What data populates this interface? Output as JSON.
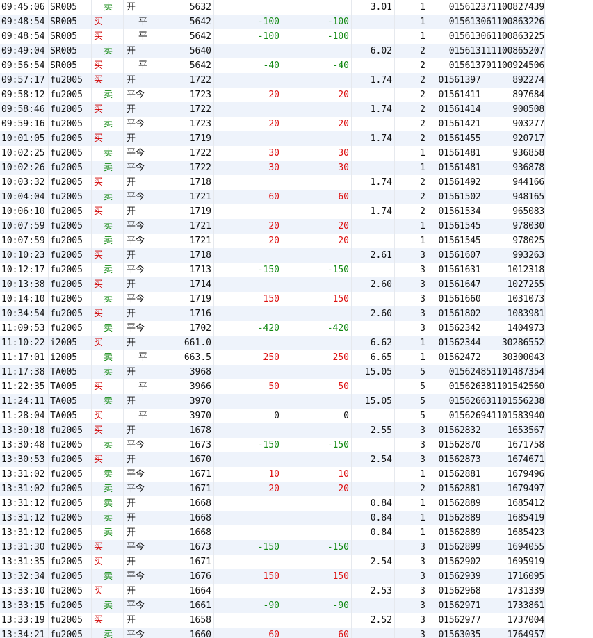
{
  "rows": [
    {
      "time": "09:45:06",
      "code": "SR005",
      "side": "卖",
      "oc": "开",
      "price": "5632",
      "pnl": "",
      "pnl2": "",
      "fee": "3.01",
      "lots": "1",
      "order": "015612371100827439"
    },
    {
      "time": "09:48:54",
      "code": "SR005",
      "side": "买",
      "oc": "平",
      "price": "5642",
      "pnl": "-100",
      "pnl2": "-100",
      "fee": "",
      "lots": "1",
      "order": "015613061100863226"
    },
    {
      "time": "09:48:54",
      "code": "SR005",
      "side": "买",
      "oc": "平",
      "price": "5642",
      "pnl": "-100",
      "pnl2": "-100",
      "fee": "",
      "lots": "1",
      "order": "015613061100863225"
    },
    {
      "time": "09:49:04",
      "code": "SR005",
      "side": "卖",
      "oc": "开",
      "price": "5640",
      "pnl": "",
      "pnl2": "",
      "fee": "6.02",
      "lots": "2",
      "order": "015613111100865207"
    },
    {
      "time": "09:56:54",
      "code": "SR005",
      "side": "买",
      "oc": "平",
      "price": "5642",
      "pnl": "-40",
      "pnl2": "-40",
      "fee": "",
      "lots": "2",
      "order": "015613791100924506"
    },
    {
      "time": "09:57:17",
      "code": "fu2005",
      "side": "买",
      "oc": "开",
      "price": "1722",
      "pnl": "",
      "pnl2": "",
      "fee": "1.74",
      "lots": "2",
      "order": "01561397      892274"
    },
    {
      "time": "09:58:12",
      "code": "fu2005",
      "side": "卖",
      "oc": "平今",
      "price": "1723",
      "pnl": "20",
      "pnl2": "20",
      "fee": "",
      "lots": "2",
      "order": "01561411      897684"
    },
    {
      "time": "09:58:46",
      "code": "fu2005",
      "side": "买",
      "oc": "开",
      "price": "1722",
      "pnl": "",
      "pnl2": "",
      "fee": "1.74",
      "lots": "2",
      "order": "01561414      900508"
    },
    {
      "time": "09:59:16",
      "code": "fu2005",
      "side": "卖",
      "oc": "平今",
      "price": "1723",
      "pnl": "20",
      "pnl2": "20",
      "fee": "",
      "lots": "2",
      "order": "01561421      903277"
    },
    {
      "time": "10:01:05",
      "code": "fu2005",
      "side": "买",
      "oc": "开",
      "price": "1719",
      "pnl": "",
      "pnl2": "",
      "fee": "1.74",
      "lots": "2",
      "order": "01561455      920717"
    },
    {
      "time": "10:02:25",
      "code": "fu2005",
      "side": "卖",
      "oc": "平今",
      "price": "1722",
      "pnl": "30",
      "pnl2": "30",
      "fee": "",
      "lots": "1",
      "order": "01561481      936858"
    },
    {
      "time": "10:02:26",
      "code": "fu2005",
      "side": "卖",
      "oc": "平今",
      "price": "1722",
      "pnl": "30",
      "pnl2": "30",
      "fee": "",
      "lots": "1",
      "order": "01561481      936878"
    },
    {
      "time": "10:03:32",
      "code": "fu2005",
      "side": "买",
      "oc": "开",
      "price": "1718",
      "pnl": "",
      "pnl2": "",
      "fee": "1.74",
      "lots": "2",
      "order": "01561492      944166"
    },
    {
      "time": "10:04:04",
      "code": "fu2005",
      "side": "卖",
      "oc": "平今",
      "price": "1721",
      "pnl": "60",
      "pnl2": "60",
      "fee": "",
      "lots": "2",
      "order": "01561502      948165"
    },
    {
      "time": "10:06:10",
      "code": "fu2005",
      "side": "买",
      "oc": "开",
      "price": "1719",
      "pnl": "",
      "pnl2": "",
      "fee": "1.74",
      "lots": "2",
      "order": "01561534      965083"
    },
    {
      "time": "10:07:59",
      "code": "fu2005",
      "side": "卖",
      "oc": "平今",
      "price": "1721",
      "pnl": "20",
      "pnl2": "20",
      "fee": "",
      "lots": "1",
      "order": "01561545      978030"
    },
    {
      "time": "10:07:59",
      "code": "fu2005",
      "side": "卖",
      "oc": "平今",
      "price": "1721",
      "pnl": "20",
      "pnl2": "20",
      "fee": "",
      "lots": "1",
      "order": "01561545      978025"
    },
    {
      "time": "10:10:23",
      "code": "fu2005",
      "side": "买",
      "oc": "开",
      "price": "1718",
      "pnl": "",
      "pnl2": "",
      "fee": "2.61",
      "lots": "3",
      "order": "01561607      993263"
    },
    {
      "time": "10:12:17",
      "code": "fu2005",
      "side": "卖",
      "oc": "平今",
      "price": "1713",
      "pnl": "-150",
      "pnl2": "-150",
      "fee": "",
      "lots": "3",
      "order": "01561631     1012318"
    },
    {
      "time": "10:13:38",
      "code": "fu2005",
      "side": "买",
      "oc": "开",
      "price": "1714",
      "pnl": "",
      "pnl2": "",
      "fee": "2.60",
      "lots": "3",
      "order": "01561647     1027255"
    },
    {
      "time": "10:14:10",
      "code": "fu2005",
      "side": "卖",
      "oc": "平今",
      "price": "1719",
      "pnl": "150",
      "pnl2": "150",
      "fee": "",
      "lots": "3",
      "order": "01561660     1031073"
    },
    {
      "time": "10:34:54",
      "code": "fu2005",
      "side": "买",
      "oc": "开",
      "price": "1716",
      "pnl": "",
      "pnl2": "",
      "fee": "2.60",
      "lots": "3",
      "order": "01561802     1083981"
    },
    {
      "time": "11:09:53",
      "code": "fu2005",
      "side": "卖",
      "oc": "平今",
      "price": "1702",
      "pnl": "-420",
      "pnl2": "-420",
      "fee": "",
      "lots": "3",
      "order": "01562342     1404973"
    },
    {
      "time": "11:10:22",
      "code": "i2005",
      "side": "买",
      "oc": "开",
      "price": "661.0",
      "pnl": "",
      "pnl2": "",
      "fee": "6.62",
      "lots": "1",
      "order": "01562344    30286552"
    },
    {
      "time": "11:17:01",
      "code": "i2005",
      "side": "卖",
      "oc": "平",
      "price": "663.5",
      "pnl": "250",
      "pnl2": "250",
      "fee": "6.65",
      "lots": "1",
      "order": "01562472    30300043"
    },
    {
      "time": "11:17:38",
      "code": "TA005",
      "side": "卖",
      "oc": "开",
      "price": "3968",
      "pnl": "",
      "pnl2": "",
      "fee": "15.05",
      "lots": "5",
      "order": "015624851101487354"
    },
    {
      "time": "11:22:35",
      "code": "TA005",
      "side": "买",
      "oc": "平",
      "price": "3966",
      "pnl": "50",
      "pnl2": "50",
      "fee": "",
      "lots": "5",
      "order": "015626381101542560"
    },
    {
      "time": "11:24:11",
      "code": "TA005",
      "side": "卖",
      "oc": "开",
      "price": "3970",
      "pnl": "",
      "pnl2": "",
      "fee": "15.05",
      "lots": "5",
      "order": "015626631101556238"
    },
    {
      "time": "11:28:04",
      "code": "TA005",
      "side": "买",
      "oc": "平",
      "price": "3970",
      "pnl": "0",
      "pnl2": "0",
      "fee": "",
      "lots": "5",
      "order": "015626941101583940"
    },
    {
      "time": "13:30:18",
      "code": "fu2005",
      "side": "买",
      "oc": "开",
      "price": "1678",
      "pnl": "",
      "pnl2": "",
      "fee": "2.55",
      "lots": "3",
      "order": "01562832     1653567"
    },
    {
      "time": "13:30:48",
      "code": "fu2005",
      "side": "卖",
      "oc": "平今",
      "price": "1673",
      "pnl": "-150",
      "pnl2": "-150",
      "fee": "",
      "lots": "3",
      "order": "01562870     1671758"
    },
    {
      "time": "13:30:53",
      "code": "fu2005",
      "side": "买",
      "oc": "开",
      "price": "1670",
      "pnl": "",
      "pnl2": "",
      "fee": "2.54",
      "lots": "3",
      "order": "01562873     1674671"
    },
    {
      "time": "13:31:02",
      "code": "fu2005",
      "side": "卖",
      "oc": "平今",
      "price": "1671",
      "pnl": "10",
      "pnl2": "10",
      "fee": "",
      "lots": "1",
      "order": "01562881     1679496"
    },
    {
      "time": "13:31:02",
      "code": "fu2005",
      "side": "卖",
      "oc": "平今",
      "price": "1671",
      "pnl": "20",
      "pnl2": "20",
      "fee": "",
      "lots": "2",
      "order": "01562881     1679497"
    },
    {
      "time": "13:31:12",
      "code": "fu2005",
      "side": "卖",
      "oc": "开",
      "price": "1668",
      "pnl": "",
      "pnl2": "",
      "fee": "0.84",
      "lots": "1",
      "order": "01562889     1685412"
    },
    {
      "time": "13:31:12",
      "code": "fu2005",
      "side": "卖",
      "oc": "开",
      "price": "1668",
      "pnl": "",
      "pnl2": "",
      "fee": "0.84",
      "lots": "1",
      "order": "01562889     1685419"
    },
    {
      "time": "13:31:12",
      "code": "fu2005",
      "side": "卖",
      "oc": "开",
      "price": "1668",
      "pnl": "",
      "pnl2": "",
      "fee": "0.84",
      "lots": "1",
      "order": "01562889     1685423"
    },
    {
      "time": "13:31:30",
      "code": "fu2005",
      "side": "买",
      "oc": "平今",
      "price": "1673",
      "pnl": "-150",
      "pnl2": "-150",
      "fee": "",
      "lots": "3",
      "order": "01562899     1694055"
    },
    {
      "time": "13:31:35",
      "code": "fu2005",
      "side": "买",
      "oc": "开",
      "price": "1671",
      "pnl": "",
      "pnl2": "",
      "fee": "2.54",
      "lots": "3",
      "order": "01562902     1695919"
    },
    {
      "time": "13:32:34",
      "code": "fu2005",
      "side": "卖",
      "oc": "平今",
      "price": "1676",
      "pnl": "150",
      "pnl2": "150",
      "fee": "",
      "lots": "3",
      "order": "01562939     1716095"
    },
    {
      "time": "13:33:10",
      "code": "fu2005",
      "side": "买",
      "oc": "开",
      "price": "1664",
      "pnl": "",
      "pnl2": "",
      "fee": "2.53",
      "lots": "3",
      "order": "01562968     1731339"
    },
    {
      "time": "13:33:15",
      "code": "fu2005",
      "side": "卖",
      "oc": "平今",
      "price": "1661",
      "pnl": "-90",
      "pnl2": "-90",
      "fee": "",
      "lots": "3",
      "order": "01562971     1733861"
    },
    {
      "time": "13:33:19",
      "code": "fu2005",
      "side": "买",
      "oc": "开",
      "price": "1658",
      "pnl": "",
      "pnl2": "",
      "fee": "2.52",
      "lots": "3",
      "order": "01562977     1737004"
    },
    {
      "time": "13:34:21",
      "code": "fu2005",
      "side": "卖",
      "oc": "平今",
      "price": "1660",
      "pnl": "60",
      "pnl2": "60",
      "fee": "",
      "lots": "3",
      "order": "01563035     1764957"
    }
  ],
  "colors": {
    "buy": "#d00000",
    "sell": "#118811",
    "positive": "#dd1111",
    "negative": "#118811",
    "row_alt": "#eef3fb"
  }
}
